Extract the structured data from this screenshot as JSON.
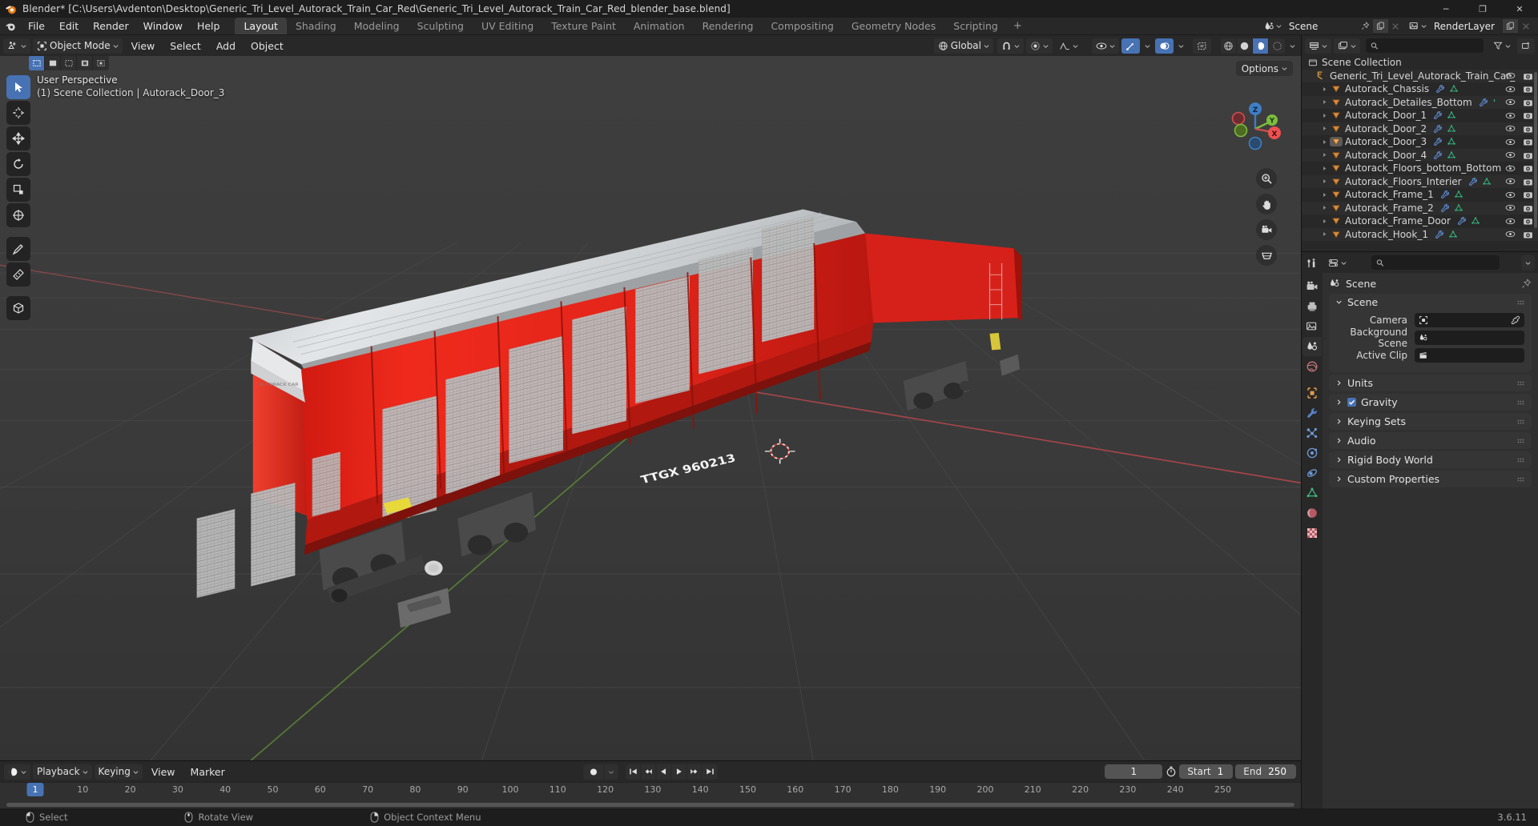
{
  "window": {
    "title": "Blender* [C:\\Users\\Avdenton\\Desktop\\Generic_Tri_Level_Autorack_Train_Car_Red\\Generic_Tri_Level_Autorack_Train_Car_Red_blender_base.blend]",
    "minimize": "─",
    "maximize": "❐",
    "close": "✕"
  },
  "menus": [
    "File",
    "Edit",
    "Render",
    "Window",
    "Help"
  ],
  "workspace_tabs": [
    {
      "label": "Layout",
      "active": true
    },
    {
      "label": "Shading",
      "active": false
    },
    {
      "label": "Modeling",
      "active": false
    },
    {
      "label": "Sculpting",
      "active": false
    },
    {
      "label": "UV Editing",
      "active": false
    },
    {
      "label": "Texture Paint",
      "active": false
    },
    {
      "label": "Animation",
      "active": false
    },
    {
      "label": "Rendering",
      "active": false
    },
    {
      "label": "Compositing",
      "active": false
    },
    {
      "label": "Geometry Nodes",
      "active": false
    },
    {
      "label": "Scripting",
      "active": false
    }
  ],
  "workspace_add": "+",
  "topbar_right": {
    "scene_name": "Scene",
    "viewlayer_name": "RenderLayer"
  },
  "viewport": {
    "mode": "Object Mode",
    "menus": [
      "View",
      "Select",
      "Add",
      "Object"
    ],
    "transform_orientation": "Global",
    "options_label": "Options",
    "overlay_line1": "User Perspective",
    "overlay_line2": "(1) Scene Collection | Autorack_Door_3",
    "gizmo_axes": {
      "x": "X",
      "y": "Y",
      "z": "Z"
    }
  },
  "timeline": {
    "editor_menus": [
      "Playback",
      "Keying",
      "View",
      "Marker"
    ],
    "current_frame": "1",
    "start_label": "Start",
    "start_value": "1",
    "end_label": "End",
    "end_value": "250",
    "ticks": [
      "10",
      "20",
      "30",
      "40",
      "50",
      "60",
      "70",
      "80",
      "90",
      "100",
      "110",
      "120",
      "130",
      "140",
      "150",
      "160",
      "170",
      "180",
      "190",
      "200",
      "210",
      "220",
      "230",
      "240",
      "250"
    ],
    "playhead_label": "1"
  },
  "outliner": {
    "search_placeholder": "",
    "scene_collection": "Scene Collection",
    "collection_name": "Generic_Tri_Level_Autorack_Train_Car_",
    "objects": [
      {
        "name": "Autorack_Chassis",
        "selected": false,
        "modifier": true,
        "mesh": true
      },
      {
        "name": "Autorack_Detailes_Bottom",
        "selected": false,
        "modifier": true,
        "mesh": false
      },
      {
        "name": "Autorack_Door_1",
        "selected": false,
        "modifier": true,
        "mesh": true
      },
      {
        "name": "Autorack_Door_2",
        "selected": false,
        "modifier": true,
        "mesh": true
      },
      {
        "name": "Autorack_Door_3",
        "selected": true,
        "modifier": true,
        "mesh": true
      },
      {
        "name": "Autorack_Door_4",
        "selected": false,
        "modifier": true,
        "mesh": true
      },
      {
        "name": "Autorack_Floors_bottom_Bottom",
        "selected": false,
        "modifier": false,
        "mesh": false
      },
      {
        "name": "Autorack_Floors_Interier",
        "selected": false,
        "modifier": true,
        "mesh": true
      },
      {
        "name": "Autorack_Frame_1",
        "selected": false,
        "modifier": true,
        "mesh": true
      },
      {
        "name": "Autorack_Frame_2",
        "selected": false,
        "modifier": true,
        "mesh": true
      },
      {
        "name": "Autorack_Frame_Door",
        "selected": false,
        "modifier": true,
        "mesh": true
      },
      {
        "name": "Autorack_Hook_1",
        "selected": false,
        "modifier": true,
        "mesh": true
      }
    ]
  },
  "properties": {
    "search_placeholder": "",
    "breadcrumb": "Scene",
    "panels": [
      {
        "title": "Scene",
        "open": true,
        "checkbox": false
      },
      {
        "title": "Units",
        "open": false,
        "checkbox": false
      },
      {
        "title": "Gravity",
        "open": false,
        "checkbox": true,
        "checked": true
      },
      {
        "title": "Keying Sets",
        "open": false,
        "checkbox": false
      },
      {
        "title": "Audio",
        "open": false,
        "checkbox": false
      },
      {
        "title": "Rigid Body World",
        "open": false,
        "checkbox": false
      },
      {
        "title": "Custom Properties",
        "open": false,
        "checkbox": false
      }
    ],
    "scene_fields": [
      {
        "label": "Camera",
        "value": "",
        "icon": "camera-icon",
        "eyedropper": true
      },
      {
        "label": "Background Scene",
        "value": "",
        "icon": "scene-icon",
        "eyedropper": false
      },
      {
        "label": "Active Clip",
        "value": "",
        "icon": "clip-icon",
        "eyedropper": false
      }
    ]
  },
  "statusbar": {
    "items": [
      {
        "icon": "mouse-left-icon",
        "label": "Select"
      },
      {
        "icon": "mouse-middle-icon",
        "label": "Rotate View"
      },
      {
        "icon": "mouse-right-icon",
        "label": "Object Context Menu"
      }
    ],
    "version": "3.6.11"
  },
  "colors": {
    "accent": "#4772b3",
    "bg_dark": "#1d1d1d",
    "bg_header": "#282828",
    "bg_panel": "#303030",
    "viewport": "#3b3b3b",
    "train_red": "#e8241c",
    "train_roof": "#cfd2d4",
    "axis_x": "#cf4f51",
    "axis_y": "#7bbd3c",
    "axis_z": "#3d7fc6"
  }
}
